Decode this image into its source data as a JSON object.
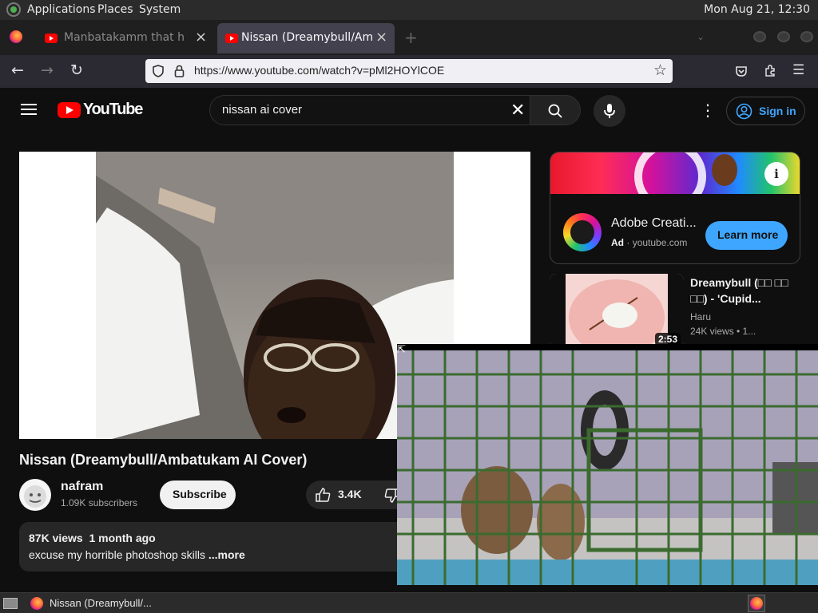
{
  "top_panel": {
    "applications": "Applications",
    "places": "Places",
    "system": "System",
    "clock": "Mon Aug 21, 12:30"
  },
  "browser": {
    "tabs": [
      {
        "title": "Manbatakamm that ha",
        "active": false
      },
      {
        "title": "Nissan (Dreamybull/Ambatu",
        "active": true
      }
    ],
    "url": "https://www.youtube.com/watch?v=pMl2HOYlCOE"
  },
  "youtube": {
    "logo_text": "YouTube",
    "search_value": "nissan ai cover",
    "sign_in": "Sign in",
    "video": {
      "title": "Nissan (Dreamybull/Ambatukam AI Cover)",
      "channel": "nafram",
      "subscribers": "1.09K subscribers",
      "subscribe": "Subscribe",
      "likes": "3.4K",
      "meta": "87K views  1 month ago",
      "description": "excuse my horrible photoshop skills",
      "more": "...more"
    },
    "ad": {
      "title": "Adobe Creati...",
      "label": "Ad",
      "domain": "youtube.com",
      "cta": "Learn more"
    },
    "recommended": {
      "title": "Dreamybull (□□ □□ □□) - 'Cupid...",
      "channel": "Haru",
      "views": "24K views  • 1...",
      "duration": "2:53"
    }
  },
  "taskbar": {
    "task_label": "Nissan (Dreamybull/..."
  }
}
